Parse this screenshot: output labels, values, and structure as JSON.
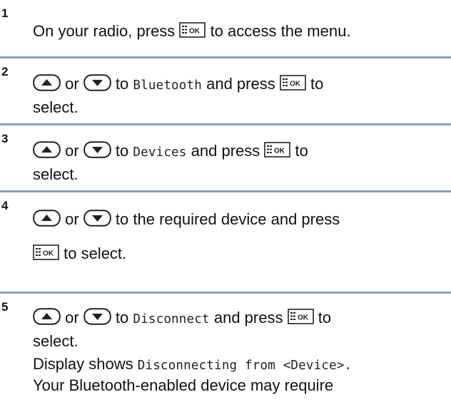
{
  "steps": [
    {
      "number": "1",
      "line1_before": "On your radio, press",
      "line1_after": " to access the menu."
    },
    {
      "number": "2",
      "or": " or ",
      "to": " to ",
      "menu_item": "Bluetooth",
      "and_press": " and press ",
      "to_end": " to",
      "line2": "select."
    },
    {
      "number": "3",
      "or": " or ",
      "to": " to ",
      "menu_item": "Devices",
      "and_press": " and press ",
      "to_end": " to",
      "line2": "select."
    },
    {
      "number": "4",
      "or": " or ",
      "line1_after": " to the required device and press",
      "line2_after": " to select."
    },
    {
      "number": "5",
      "or": " or ",
      "to": " to ",
      "menu_item": "Disconnect",
      "and_press": " and press ",
      "to_end": " to",
      "line2": "select.",
      "line3_before": "Display shows ",
      "line3_mono": "Disconnecting from <Device>.",
      "line4": "Your Bluetooth-enabled device may require"
    }
  ],
  "icons": {
    "menu_ok": "menu-ok-key-icon",
    "up": "up-arrow-key-icon",
    "down": "down-arrow-key-icon"
  },
  "colors": {
    "divider": "#8a9fb2",
    "text": "#111111"
  }
}
